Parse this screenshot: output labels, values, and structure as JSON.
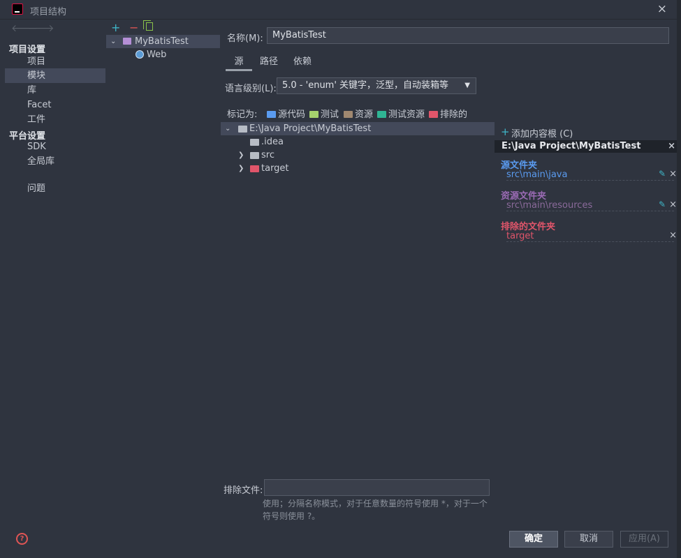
{
  "window": {
    "title": "项目结构",
    "close_icon": "×"
  },
  "nav": {
    "back": "🡐",
    "forward": "🡒",
    "group_project": "项目设置",
    "items_project": [
      "项目",
      "模块",
      "库",
      "Facet",
      "工件"
    ],
    "group_platform": "平台设置",
    "items_platform": [
      "SDK",
      "全局库"
    ],
    "problems": "问题"
  },
  "module_tree": {
    "add": "+",
    "remove": "−",
    "module": "MyBatisTest",
    "facet": "Web"
  },
  "form": {
    "name_label": "名称(M):",
    "name_value": "MyBatisTest",
    "tabs": [
      "源",
      "路径",
      "依赖"
    ],
    "lang_label": "语言级别(L):",
    "lang_value": "5.0 - 'enum' 关键字，泛型，自动装箱等",
    "mark_label": "标记为:",
    "marks": [
      "源代码",
      "测试",
      "资源",
      "测试资源",
      "排除的"
    ],
    "exclude_label": "排除文件:",
    "exclude_value": "",
    "hint": "使用；分隔名称模式，对于任意数量的符号使用 *，对于一个符号则使用 ?。"
  },
  "file_tree": {
    "root": "E:\\Java Project\\MyBatisTest",
    "children": [
      ".idea",
      "src",
      "target"
    ]
  },
  "content_roots": {
    "add_label": "添加内容根 (C)",
    "root": "E:\\Java Project\\MyBatisTest",
    "source_title": "源文件夹",
    "source_path": "src\\main\\java",
    "resource_title": "资源文件夹",
    "resource_path": "src\\main\\resources",
    "excluded_title": "排除的文件夹",
    "excluded_path": "target"
  },
  "buttons": {
    "ok": "确定",
    "cancel": "取消",
    "apply": "应用(A)"
  },
  "colors": {
    "source": "#5a9bf0",
    "test": "#a5d26d",
    "resource": "#a08870",
    "test_resource": "#2fb594",
    "excluded": "#e0556a",
    "resource_title": "#9b6bb5"
  }
}
